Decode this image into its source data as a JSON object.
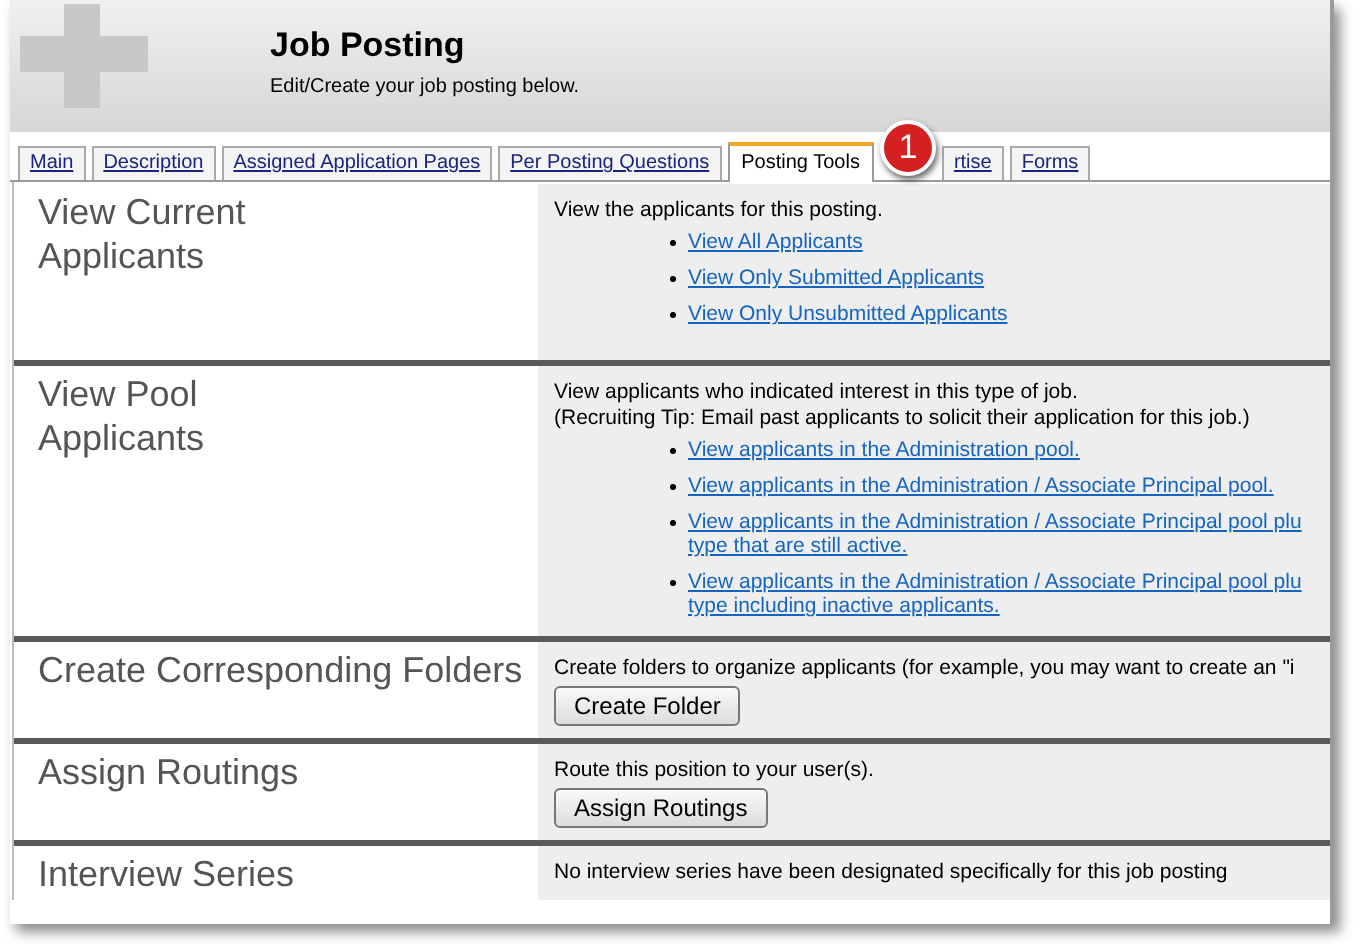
{
  "header": {
    "title": "Job Posting",
    "subtitle": "Edit/Create your job posting below."
  },
  "tabs": [
    {
      "label": "Main",
      "selected": false
    },
    {
      "label": "Description",
      "selected": false
    },
    {
      "label": "Assigned Application Pages",
      "selected": false
    },
    {
      "label": "Per Posting Questions",
      "selected": false
    },
    {
      "label": "Posting Tools",
      "selected": true
    },
    {
      "label": "rtise",
      "selected": false
    },
    {
      "label": "Forms",
      "selected": false
    }
  ],
  "callout": {
    "label": "1"
  },
  "sections": [
    {
      "title": "View Current Applicants",
      "kind": "links",
      "lines": [
        "View the applicants for this posting."
      ],
      "links": [
        [
          "View All Applicants"
        ],
        [
          "View Only Submitted Applicants"
        ],
        [
          "View Only Unsubmitted Applicants"
        ]
      ]
    },
    {
      "title": "View Pool Applicants",
      "kind": "links",
      "lines": [
        "View applicants who indicated interest in this type of job.",
        "(Recruiting Tip: Email past applicants to solicit their application for this job.)"
      ],
      "links": [
        [
          "View applicants in the Administration pool."
        ],
        [
          "View applicants in the Administration / Associate Principal pool."
        ],
        [
          "View applicants in the Administration / Associate Principal pool plu",
          "type that are still active."
        ],
        [
          "View applicants in the Administration / Associate Principal pool plu",
          "type including inactive applicants."
        ]
      ]
    },
    {
      "title": "Create Corresponding Folders",
      "kind": "button",
      "lines": [
        "Create folders to organize applicants (for example, you may want to create an \"i"
      ],
      "button": "Create Folder"
    },
    {
      "title": "Assign Routings",
      "kind": "button",
      "lines": [
        "Route this position to your user(s)."
      ],
      "button": "Assign Routings"
    },
    {
      "title": "Interview Series",
      "kind": "text",
      "lines": [
        "No interview series have been designated specifically for this job posting"
      ]
    }
  ]
}
